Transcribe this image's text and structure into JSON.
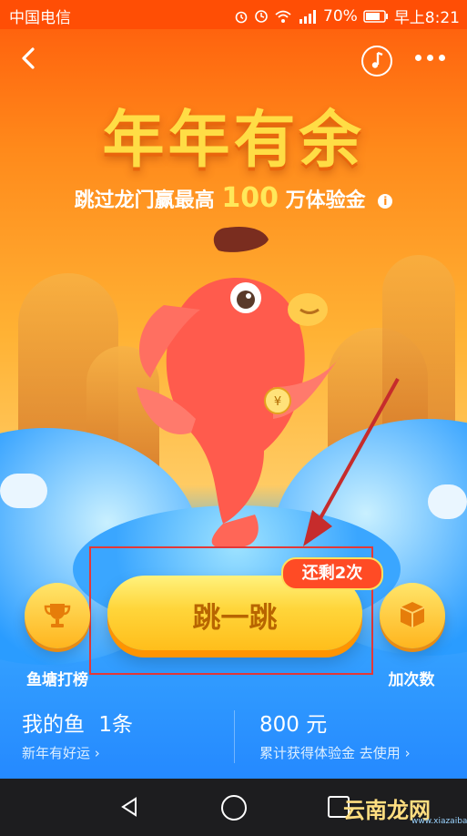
{
  "status": {
    "carrier": "中国电信",
    "battery": "70%",
    "time": "早上8:21"
  },
  "header": {
    "back_icon": "back-chevron-icon",
    "music_icon": "music-note-icon",
    "more_icon": "more-dots-icon"
  },
  "hero": {
    "title": "年年有余",
    "subtitle_prefix": "跳过龙门赢最高",
    "subtitle_num": "100",
    "subtitle_suffix": "万体验金",
    "info_icon": "i"
  },
  "actions": {
    "left_button": {
      "label": "鱼塘打榜",
      "icon": "trophy-icon"
    },
    "main_button": {
      "label": "跳一跳"
    },
    "badge": "还剩2次",
    "right_button": {
      "label": "加次数",
      "icon": "box-icon"
    }
  },
  "stats": {
    "my_fish_label": "我的鱼",
    "my_fish_count": "1条",
    "my_fish_sub": "新年有好运",
    "amount": "800 元",
    "amount_sub": "累计获得体验金 去使用"
  },
  "watermark": {
    "text": "云南龙网",
    "url": "www.xiazaiba.com"
  },
  "colors": {
    "accent": "#ff4e05",
    "title": "#ffdd45",
    "button": "#ffd53a",
    "highlight": "#e43838"
  }
}
